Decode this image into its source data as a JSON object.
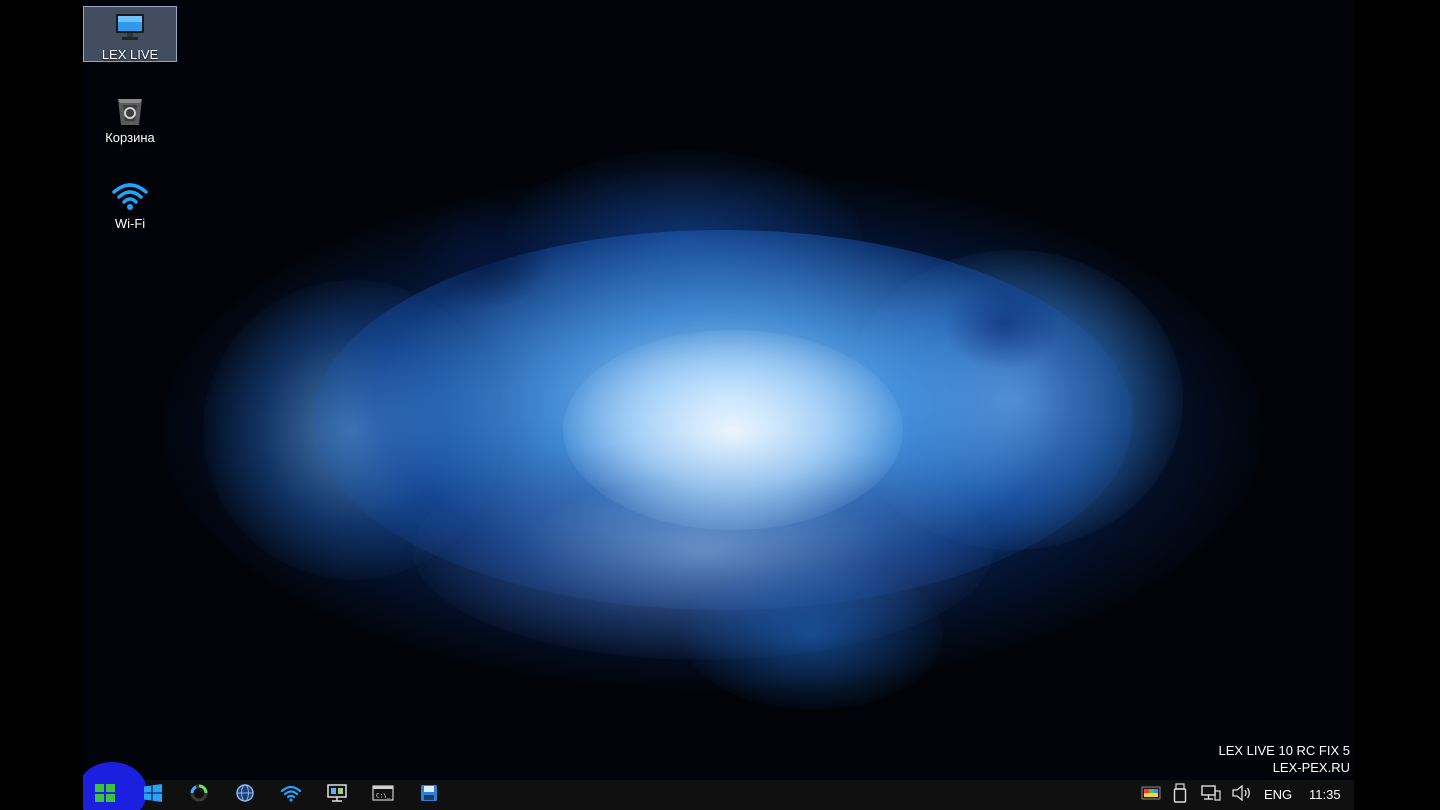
{
  "desktop": {
    "icons": [
      {
        "label": "LEX LIVE",
        "icon": "monitor-icon",
        "selected": true
      },
      {
        "label": "Корзина",
        "icon": "recycle-bin-icon",
        "selected": false
      },
      {
        "label": "Wi-Fi",
        "icon": "wifi-icon",
        "selected": false
      }
    ]
  },
  "watermark": {
    "line1": "LEX LIVE 10 RC FIX 5",
    "line2": "LEX-PEX.RU"
  },
  "taskbar": {
    "pinned": [
      {
        "icon": "start-icon",
        "color": "#3cc43c"
      },
      {
        "icon": "windows-icon",
        "color": "#2aa0ff"
      },
      {
        "icon": "loading-ring-icon"
      },
      {
        "icon": "globe-icon"
      },
      {
        "icon": "wifi-icon"
      },
      {
        "icon": "remote-desktop-icon"
      },
      {
        "icon": "command-prompt-icon"
      },
      {
        "icon": "save-disk-icon"
      }
    ],
    "tray": {
      "language": "ENG",
      "clock": "11:35",
      "icons": [
        "color-palette-icon",
        "usb-drive-icon",
        "network-icon",
        "volume-icon"
      ]
    }
  },
  "colors": {
    "taskbar_bg": "#101010",
    "start_highlight": "#1a1fe0",
    "selection_bg": "#6b7d99"
  }
}
